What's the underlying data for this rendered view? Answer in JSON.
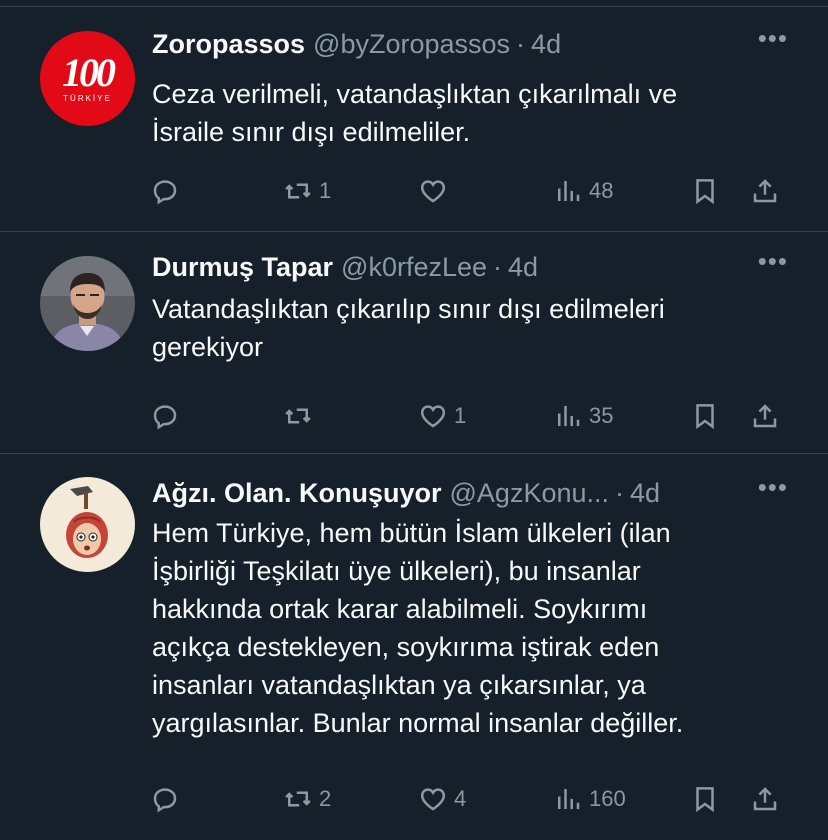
{
  "tweets": [
    {
      "name": "Zoropassos",
      "handle": "@byZoropassos",
      "time": "4d",
      "text_lines": [
        "Ceza verilmeli, vatandaşlıktan çıkarılmalı ve",
        "İsraile sınır dışı edilmeliler."
      ],
      "avatar": {
        "type": "logo",
        "big": "100",
        "small": "TÜRKİYE"
      },
      "replies": "",
      "retweets": "1",
      "likes": "",
      "views": "48"
    },
    {
      "name": "Durmuş Tapar",
      "handle": "@k0rfezLee",
      "time": "4d",
      "text_lines": [
        "Vatandaşlıktan çıkarılıp sınır dışı edilmeleri",
        "gerekiyor"
      ],
      "avatar": {
        "type": "photo"
      },
      "replies": "",
      "retweets": "",
      "likes": "1",
      "views": "35"
    },
    {
      "name": "Ağzı. Olan. Konuşuyor",
      "handle": "@AgzKonu...",
      "time": "4d",
      "text_lines": [
        "Hem Türkiye, hem bütün İslam ülkeleri (ilan",
        "İşbirliği Teşkilatı üye ülkeleri), bu insanlar",
        "hakkında ortak karar alabilmeli. Soykırımı",
        "açıkça destekleyen, soykırıma iştirak eden",
        "insanları vatandaşlıktan ya çıkarsınlar, ya",
        "yargılasınlar. Bunlar normal insanlar değiller."
      ],
      "avatar": {
        "type": "cartoon"
      },
      "replies": "",
      "retweets": "2",
      "likes": "4",
      "views": "160"
    }
  ],
  "icons": {
    "more": "more-icon",
    "reply": "reply-icon",
    "retweet": "retweet-icon",
    "like": "like-icon",
    "views": "views-icon",
    "bookmark": "bookmark-icon",
    "share": "share-icon"
  },
  "ui": {
    "more_glyph": "•••",
    "dot": "·"
  },
  "colors": {
    "background": "#15202b",
    "text": "#f7f9f9",
    "muted": "#8b98a5",
    "divider": "#38444d"
  }
}
